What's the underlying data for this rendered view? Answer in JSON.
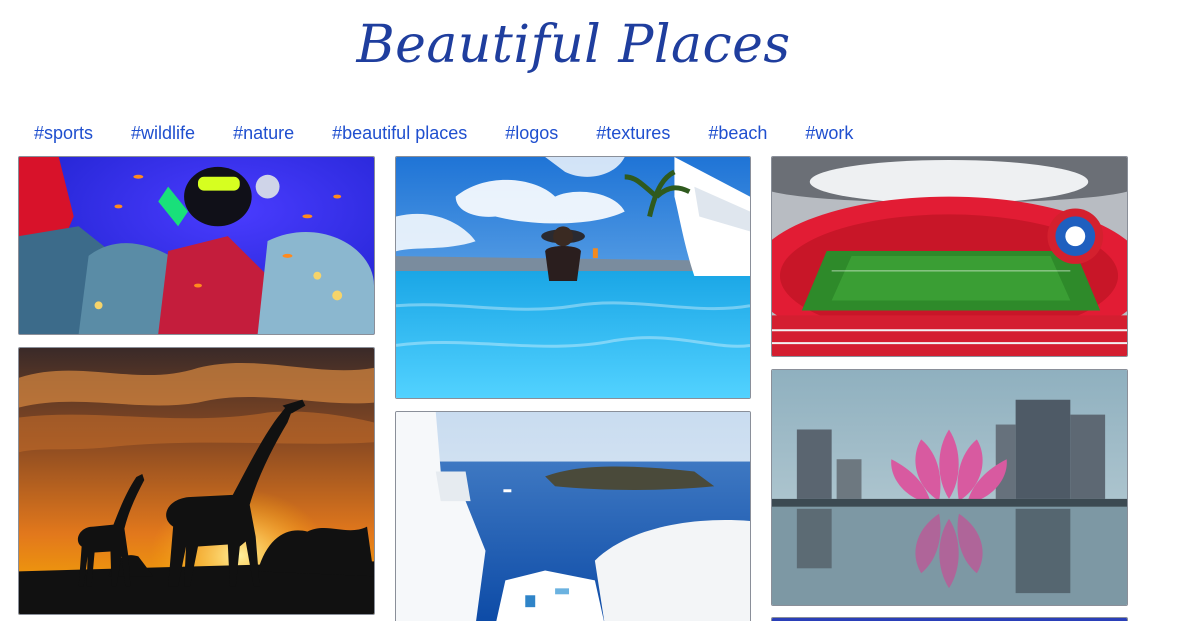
{
  "header": {
    "title": "Beautiful Places"
  },
  "tags": [
    "#sports",
    "#wildlife",
    "#nature",
    "#beautiful places",
    "#logos",
    "#textures",
    "#beach",
    "#work"
  ],
  "colors": {
    "title": "#1f3e9e",
    "tag_link": "#1f4fcf",
    "tile_border": "#8a8f99"
  },
  "gallery": {
    "images": [
      {
        "subject": "underwater-coral-reef-diver"
      },
      {
        "subject": "giraffes-sunset-silhouette"
      },
      {
        "subject": "infinity-pool-woman-hat"
      },
      {
        "subject": "santorini-blue-sea-view"
      },
      {
        "subject": "football-stadium-red-seats"
      },
      {
        "subject": "lotus-building-reflection"
      },
      {
        "subject": "partial-blue-image"
      }
    ]
  }
}
